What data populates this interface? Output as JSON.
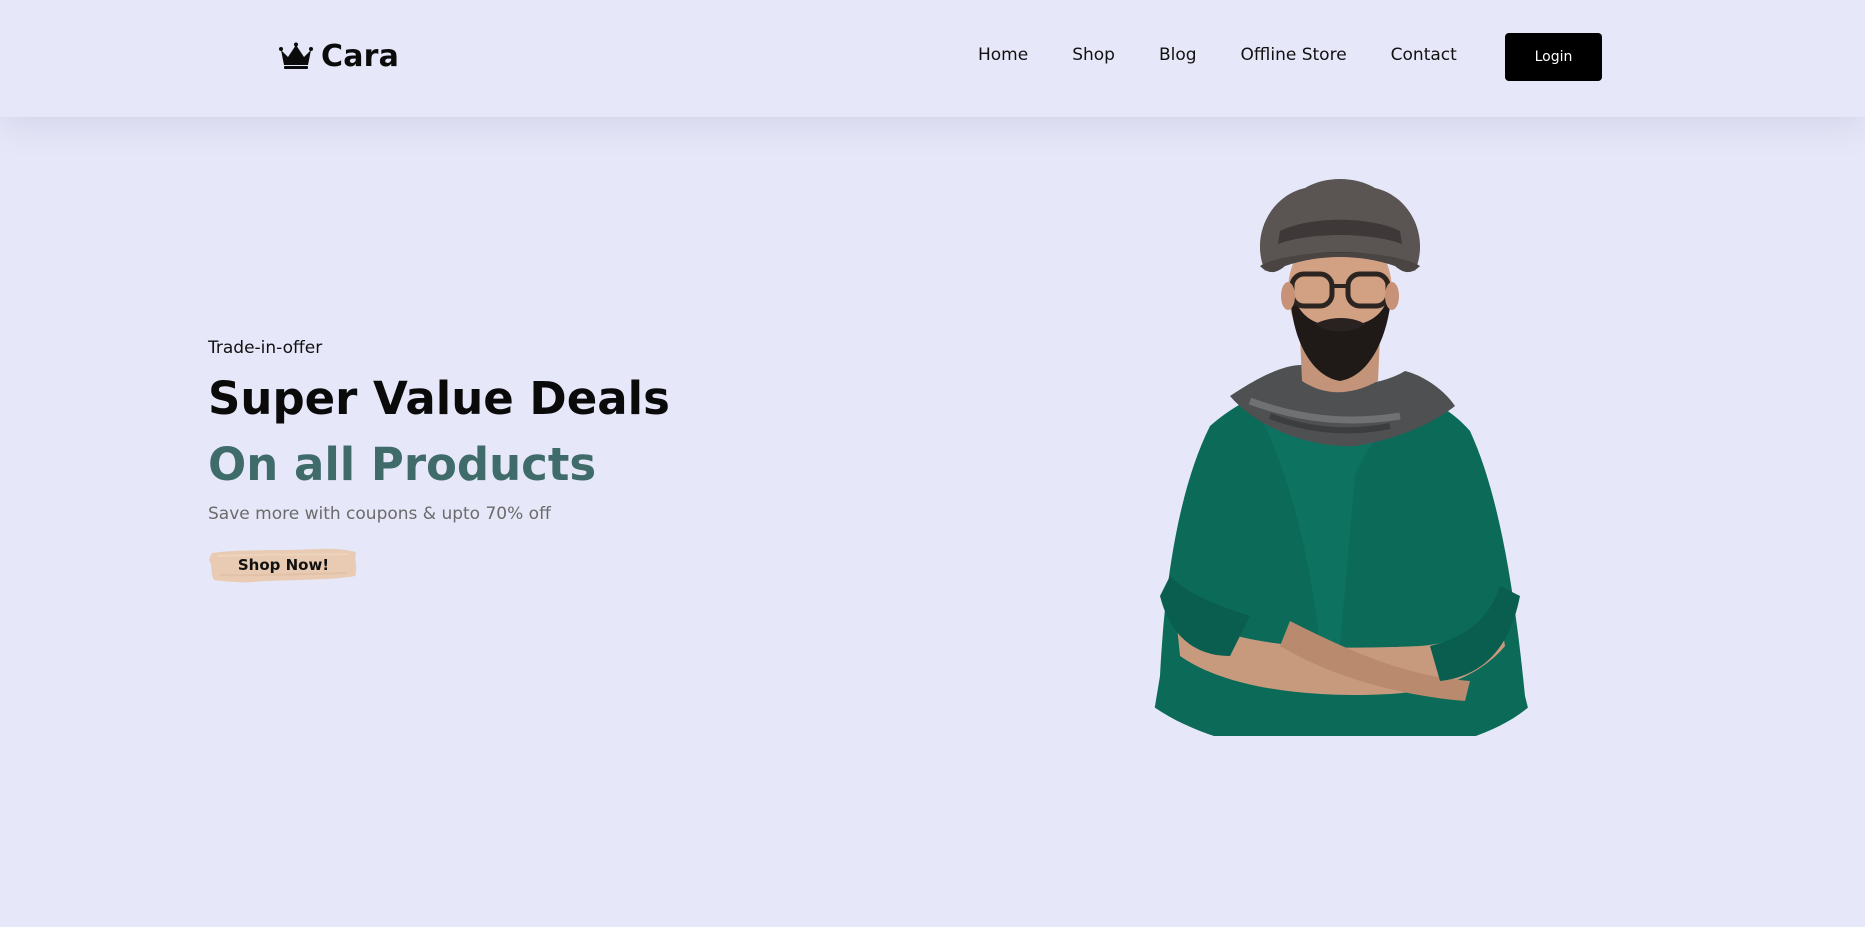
{
  "header": {
    "logo": {
      "text": "Cara",
      "icon": "crown-icon"
    },
    "nav": [
      {
        "label": "Home"
      },
      {
        "label": "Shop"
      },
      {
        "label": "Blog"
      },
      {
        "label": "Offline Store"
      },
      {
        "label": "Contact"
      }
    ],
    "login_label": "Login"
  },
  "hero": {
    "kicker": "Trade-in-offer",
    "headline": "Super Value Deals",
    "subheadline": "On all Products",
    "description": "Save more with coupons & upto 70% off",
    "cta_label": "Shop Now!",
    "image": "man-with-hat-and-glasses-in-green-sweater"
  },
  "colors": {
    "background": "#e6e7f8",
    "accent": "#3f6b6a",
    "cta_brush": "#e8cbb2",
    "login_bg": "#000000"
  }
}
